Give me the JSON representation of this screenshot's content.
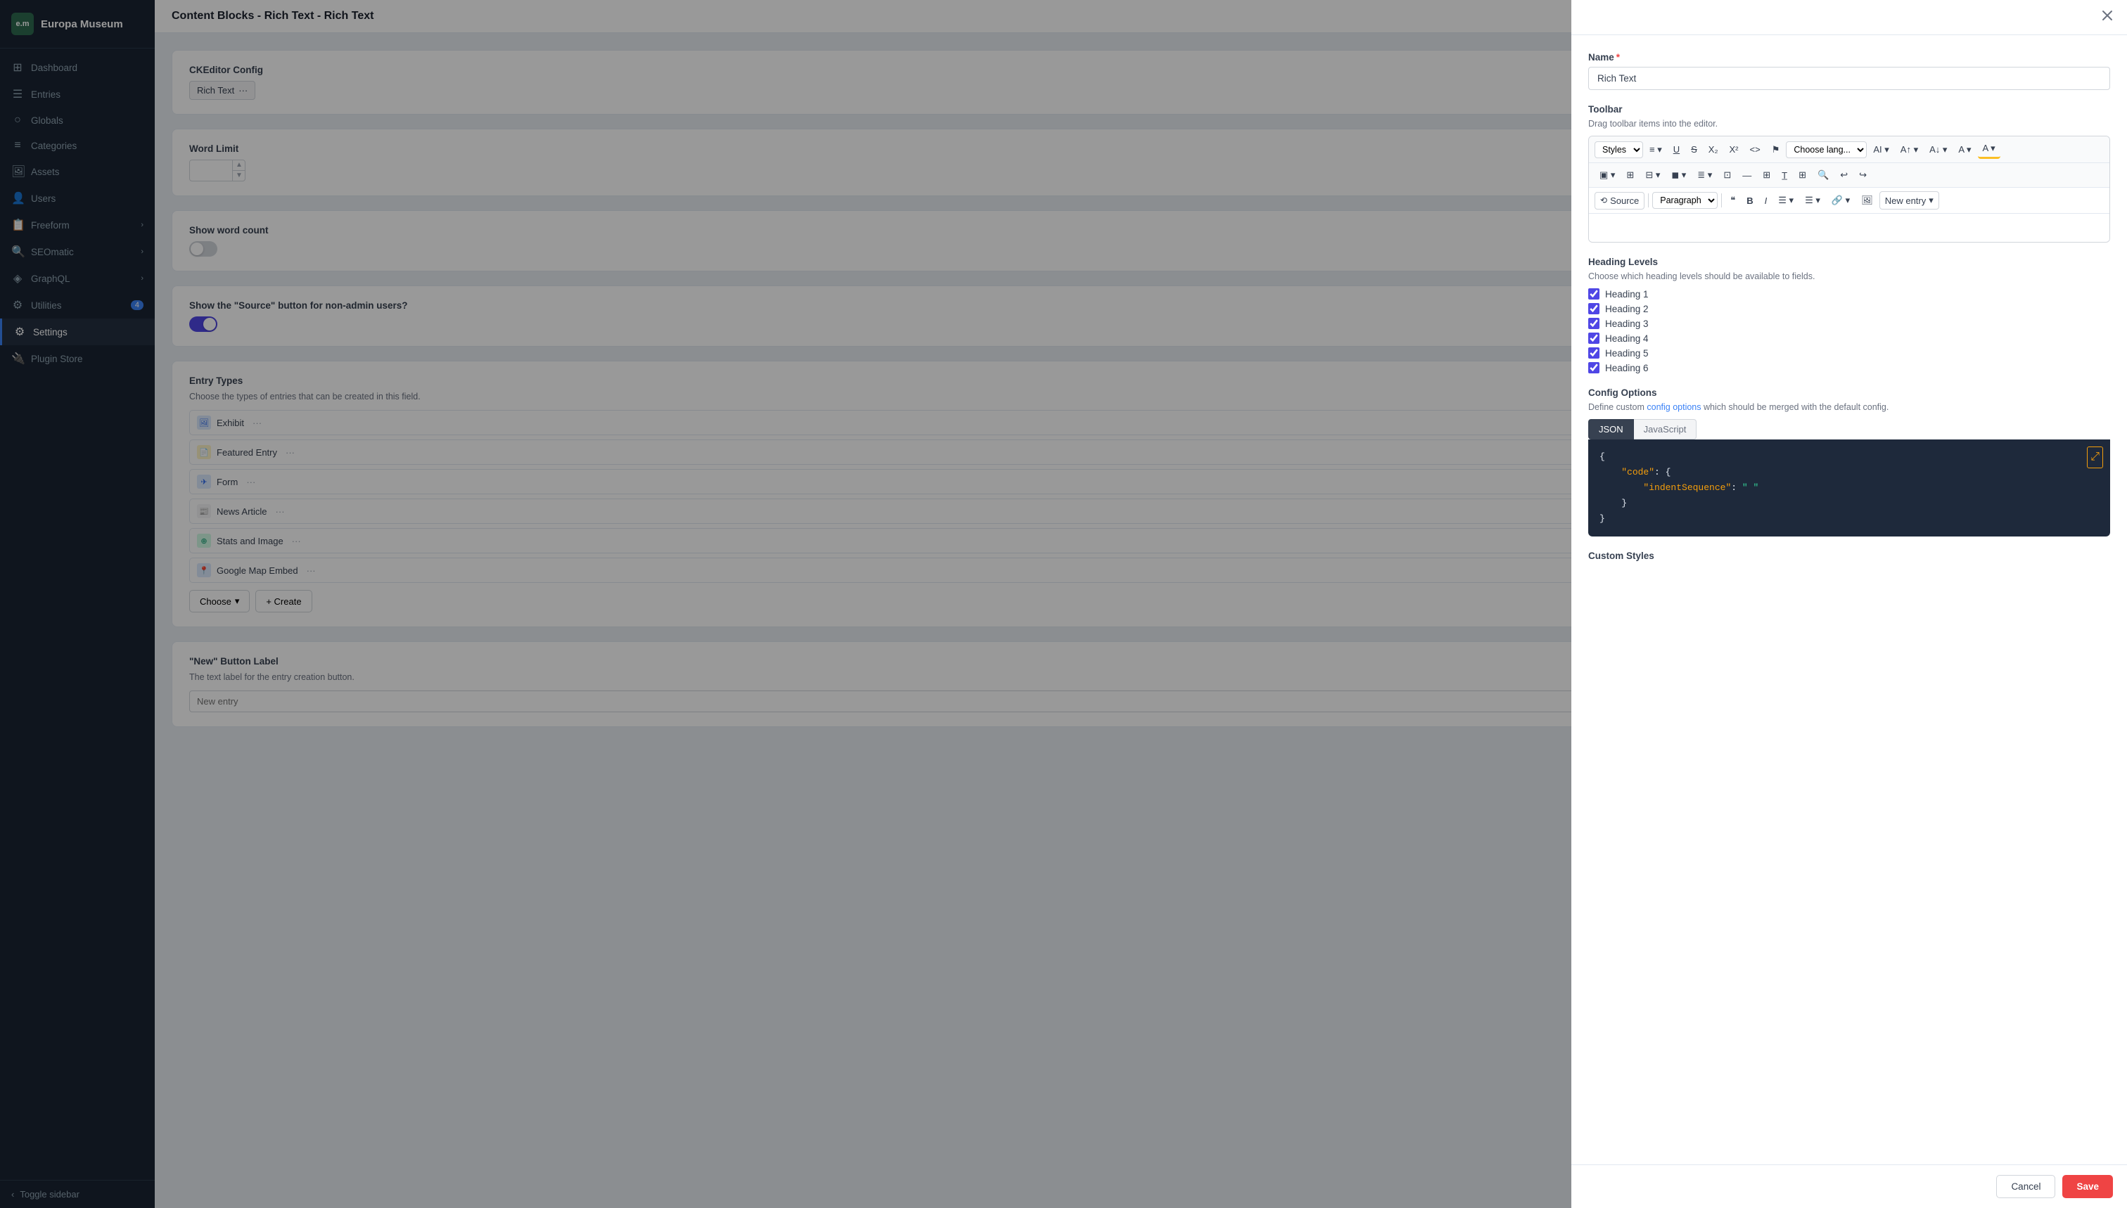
{
  "app": {
    "logo_initials": "e.m",
    "app_name": "Europa Museum"
  },
  "sidebar": {
    "items": [
      {
        "id": "dashboard",
        "label": "Dashboard",
        "icon": "⊞",
        "active": false
      },
      {
        "id": "entries",
        "label": "Entries",
        "icon": "☰",
        "active": false
      },
      {
        "id": "globals",
        "label": "Globals",
        "icon": "○",
        "active": false
      },
      {
        "id": "categories",
        "label": "Categories",
        "icon": "≡",
        "active": false
      },
      {
        "id": "assets",
        "label": "Assets",
        "icon": "🖼",
        "active": false
      },
      {
        "id": "users",
        "label": "Users",
        "icon": "👤",
        "active": false
      },
      {
        "id": "freeform",
        "label": "Freeform",
        "icon": "📋",
        "active": false,
        "has_arrow": true
      },
      {
        "id": "seomatic",
        "label": "SEOmatic",
        "icon": "🔍",
        "active": false,
        "has_arrow": true
      },
      {
        "id": "graphql",
        "label": "GraphQL",
        "icon": "◈",
        "active": false,
        "has_arrow": true
      },
      {
        "id": "utilities",
        "label": "Utilities",
        "icon": "⚙",
        "active": false,
        "badge": "4"
      },
      {
        "id": "settings",
        "label": "Settings",
        "icon": "⚙",
        "active": true
      },
      {
        "id": "plugin-store",
        "label": "Plugin Store",
        "icon": "🔌",
        "active": false
      }
    ],
    "toggle_label": "Toggle sidebar"
  },
  "topbar": {
    "title": "Content Blocks - Rich Text - Rich Text"
  },
  "main": {
    "ckeditor_config": {
      "label": "CKEditor Config",
      "value": "Rich Text",
      "dots": "···"
    },
    "word_limit": {
      "label": "Word Limit",
      "value": ""
    },
    "show_word_count": {
      "label": "Show word count",
      "toggle_state": "off"
    },
    "show_source_button": {
      "label": "Show the \"Source\" button for non-admin users?",
      "toggle_state": "on"
    },
    "entry_types": {
      "label": "Entry Types",
      "desc": "Choose the types of entries that can be created in this field.",
      "items": [
        {
          "name": "Exhibit",
          "icon_class": "icon-exhibit",
          "icon": "🖼"
        },
        {
          "name": "Featured Entry",
          "icon_class": "icon-featured",
          "icon": "📄"
        },
        {
          "name": "Form",
          "icon_class": "icon-form",
          "icon": "✈"
        },
        {
          "name": "News Article",
          "icon_class": "icon-news",
          "icon": "📰"
        },
        {
          "name": "Stats and Image",
          "icon_class": "icon-stats",
          "icon": "⊕"
        },
        {
          "name": "Google Map Embed",
          "icon_class": "icon-map",
          "icon": "📍"
        }
      ],
      "choose_label": "Choose",
      "create_label": "+ Create"
    },
    "new_button_label": {
      "label": "\"New\" Button Label",
      "desc": "The text label for the entry creation button.",
      "placeholder": "New entry"
    }
  },
  "modal": {
    "name_label": "Name",
    "name_required": true,
    "name_value": "Rich Text",
    "toolbar_label": "Toolbar",
    "toolbar_desc": "Drag toolbar items into the editor.",
    "toolbar_row1": [
      {
        "label": "Styles",
        "type": "select"
      },
      {
        "label": "≡",
        "type": "btn"
      },
      {
        "label": "U",
        "type": "btn",
        "underline": true
      },
      {
        "label": "S",
        "type": "btn",
        "strike": true
      },
      {
        "label": "X₂",
        "type": "btn"
      },
      {
        "label": "X²",
        "type": "btn"
      },
      {
        "label": "<>",
        "type": "btn"
      },
      {
        "label": "⚑",
        "type": "btn"
      },
      {
        "label": "Choose lang...",
        "type": "select"
      },
      {
        "label": "AI↑",
        "type": "btn"
      },
      {
        "label": "A↑",
        "type": "btn"
      },
      {
        "label": "A↓",
        "type": "btn"
      },
      {
        "label": "A",
        "type": "btn"
      }
    ],
    "toolbar_row2": [
      {
        "label": "▣",
        "type": "btn"
      },
      {
        "label": "⊞",
        "type": "btn"
      },
      {
        "label": "⊟",
        "type": "btn"
      },
      {
        "label": "◼",
        "type": "btn"
      },
      {
        "label": "≣",
        "type": "btn"
      },
      {
        "label": "⊡",
        "type": "btn"
      },
      {
        "label": "—",
        "type": "btn"
      },
      {
        "label": "⊞",
        "type": "btn"
      },
      {
        "label": "T̲",
        "type": "btn"
      },
      {
        "label": "⊞",
        "type": "btn"
      },
      {
        "label": "🔍",
        "type": "btn"
      },
      {
        "label": "↩",
        "type": "btn"
      },
      {
        "label": "↪",
        "type": "btn"
      }
    ],
    "toolbar_row3_source": "Source",
    "toolbar_row3_paragraph": "Paragraph",
    "toolbar_row3_quote": "❝",
    "toolbar_row3_bold": "B",
    "toolbar_row3_italic": "I",
    "toolbar_row3_list_ul": "☰",
    "toolbar_row3_list_ol": "☰",
    "toolbar_row3_link": "🔗",
    "toolbar_row3_image": "🖼",
    "toolbar_row3_new_entry": "New entry",
    "heading_levels": {
      "label": "Heading Levels",
      "desc": "Choose which heading levels should be available to fields.",
      "items": [
        {
          "label": "Heading 1",
          "checked": true
        },
        {
          "label": "Heading 2",
          "checked": true
        },
        {
          "label": "Heading 3",
          "checked": true
        },
        {
          "label": "Heading 4",
          "checked": true
        },
        {
          "label": "Heading 5",
          "checked": true
        },
        {
          "label": "Heading 6",
          "checked": true
        }
      ]
    },
    "config_options": {
      "label": "Config Options",
      "desc_text": "Define custom ",
      "link_text": "config options",
      "desc_suffix": " which should be merged with the default config.",
      "tabs": [
        "JSON",
        "JavaScript"
      ],
      "active_tab": "JSON",
      "code": "{\n    \"code\": {\n        \"indentSequence\": \"  \"\n    }\n}"
    },
    "custom_styles_label": "Custom Styles",
    "cancel_label": "Cancel",
    "save_label": "Save"
  }
}
